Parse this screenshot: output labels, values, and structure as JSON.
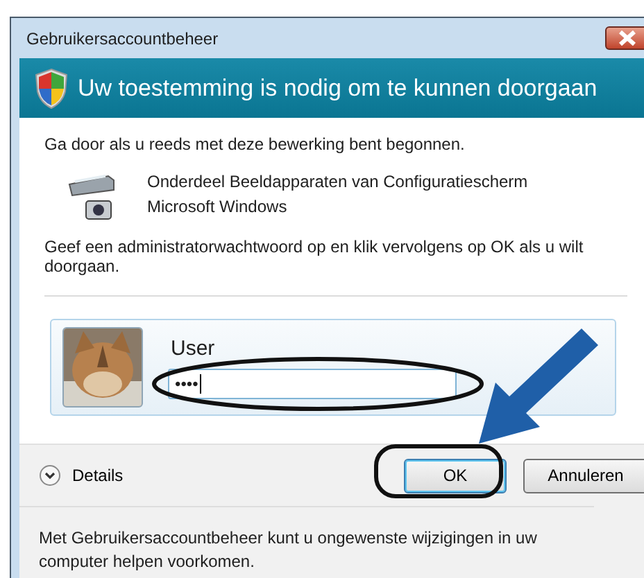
{
  "window": {
    "title": "Gebruikersaccountbeheer"
  },
  "header": {
    "title": "Uw toestemming is nodig om te kunnen doorgaan"
  },
  "intro": "Ga door als u reeds met deze bewerking bent begonnen.",
  "program": {
    "name": "Onderdeel Beeldapparaten van Configuratiescherm",
    "publisher": "Microsoft Windows"
  },
  "instruction": "Geef een administratorwachtwoord op en klik vervolgens op OK als u wilt doorgaan.",
  "account": {
    "user": "User",
    "password": "••••"
  },
  "details": {
    "label": "Details",
    "expanded": false
  },
  "buttons": [
    {
      "label": "OK",
      "default": true
    },
    {
      "label": "Annuleren",
      "default": false
    }
  ],
  "footer": "Met Gebruikersaccountbeheer kunt u ongewenste wijzigingen in uw computer helpen voorkomen."
}
